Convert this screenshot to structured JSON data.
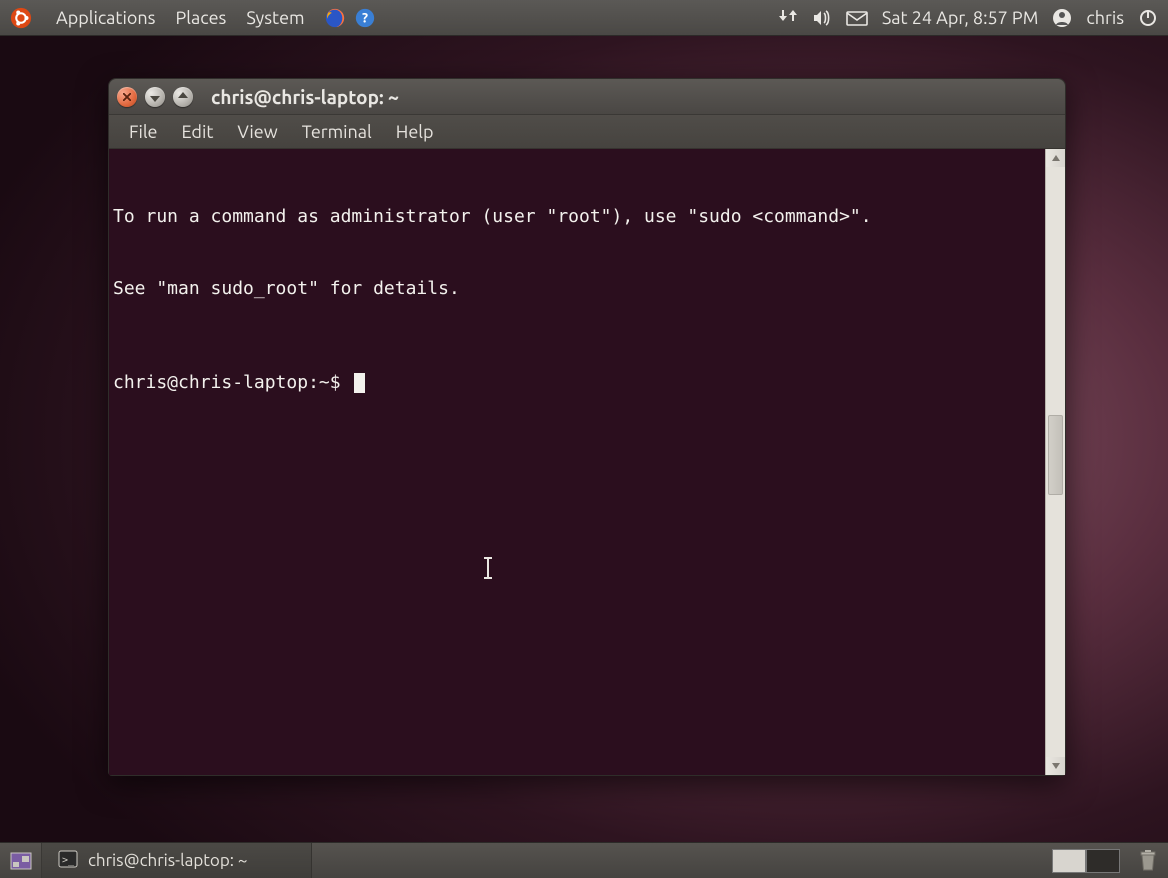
{
  "top_panel": {
    "menus": [
      "Applications",
      "Places",
      "System"
    ],
    "launchers": [
      "firefox-icon",
      "help-icon"
    ],
    "indicators": {
      "network": "network-updown-icon",
      "sound": "volume-icon",
      "mail": "mail-icon",
      "datetime": "Sat 24 Apr,  8:57 PM",
      "user_icon": "user-switch-icon",
      "username": "chris",
      "power": "power-icon"
    }
  },
  "window": {
    "title": "chris@chris-laptop: ~",
    "controls": [
      "close",
      "minimize",
      "maximize"
    ],
    "menubar": [
      "File",
      "Edit",
      "View",
      "Terminal",
      "Help"
    ]
  },
  "terminal": {
    "motd_line1": "To run a command as administrator (user \"root\"), use \"sudo <command>\".",
    "motd_line2": "See \"man sudo_root\" for details.",
    "prompt": "chris@chris-laptop:~$ "
  },
  "bottom_panel": {
    "task_title": "chris@chris-laptop: ~",
    "workspaces": 2,
    "active_workspace": 0
  }
}
